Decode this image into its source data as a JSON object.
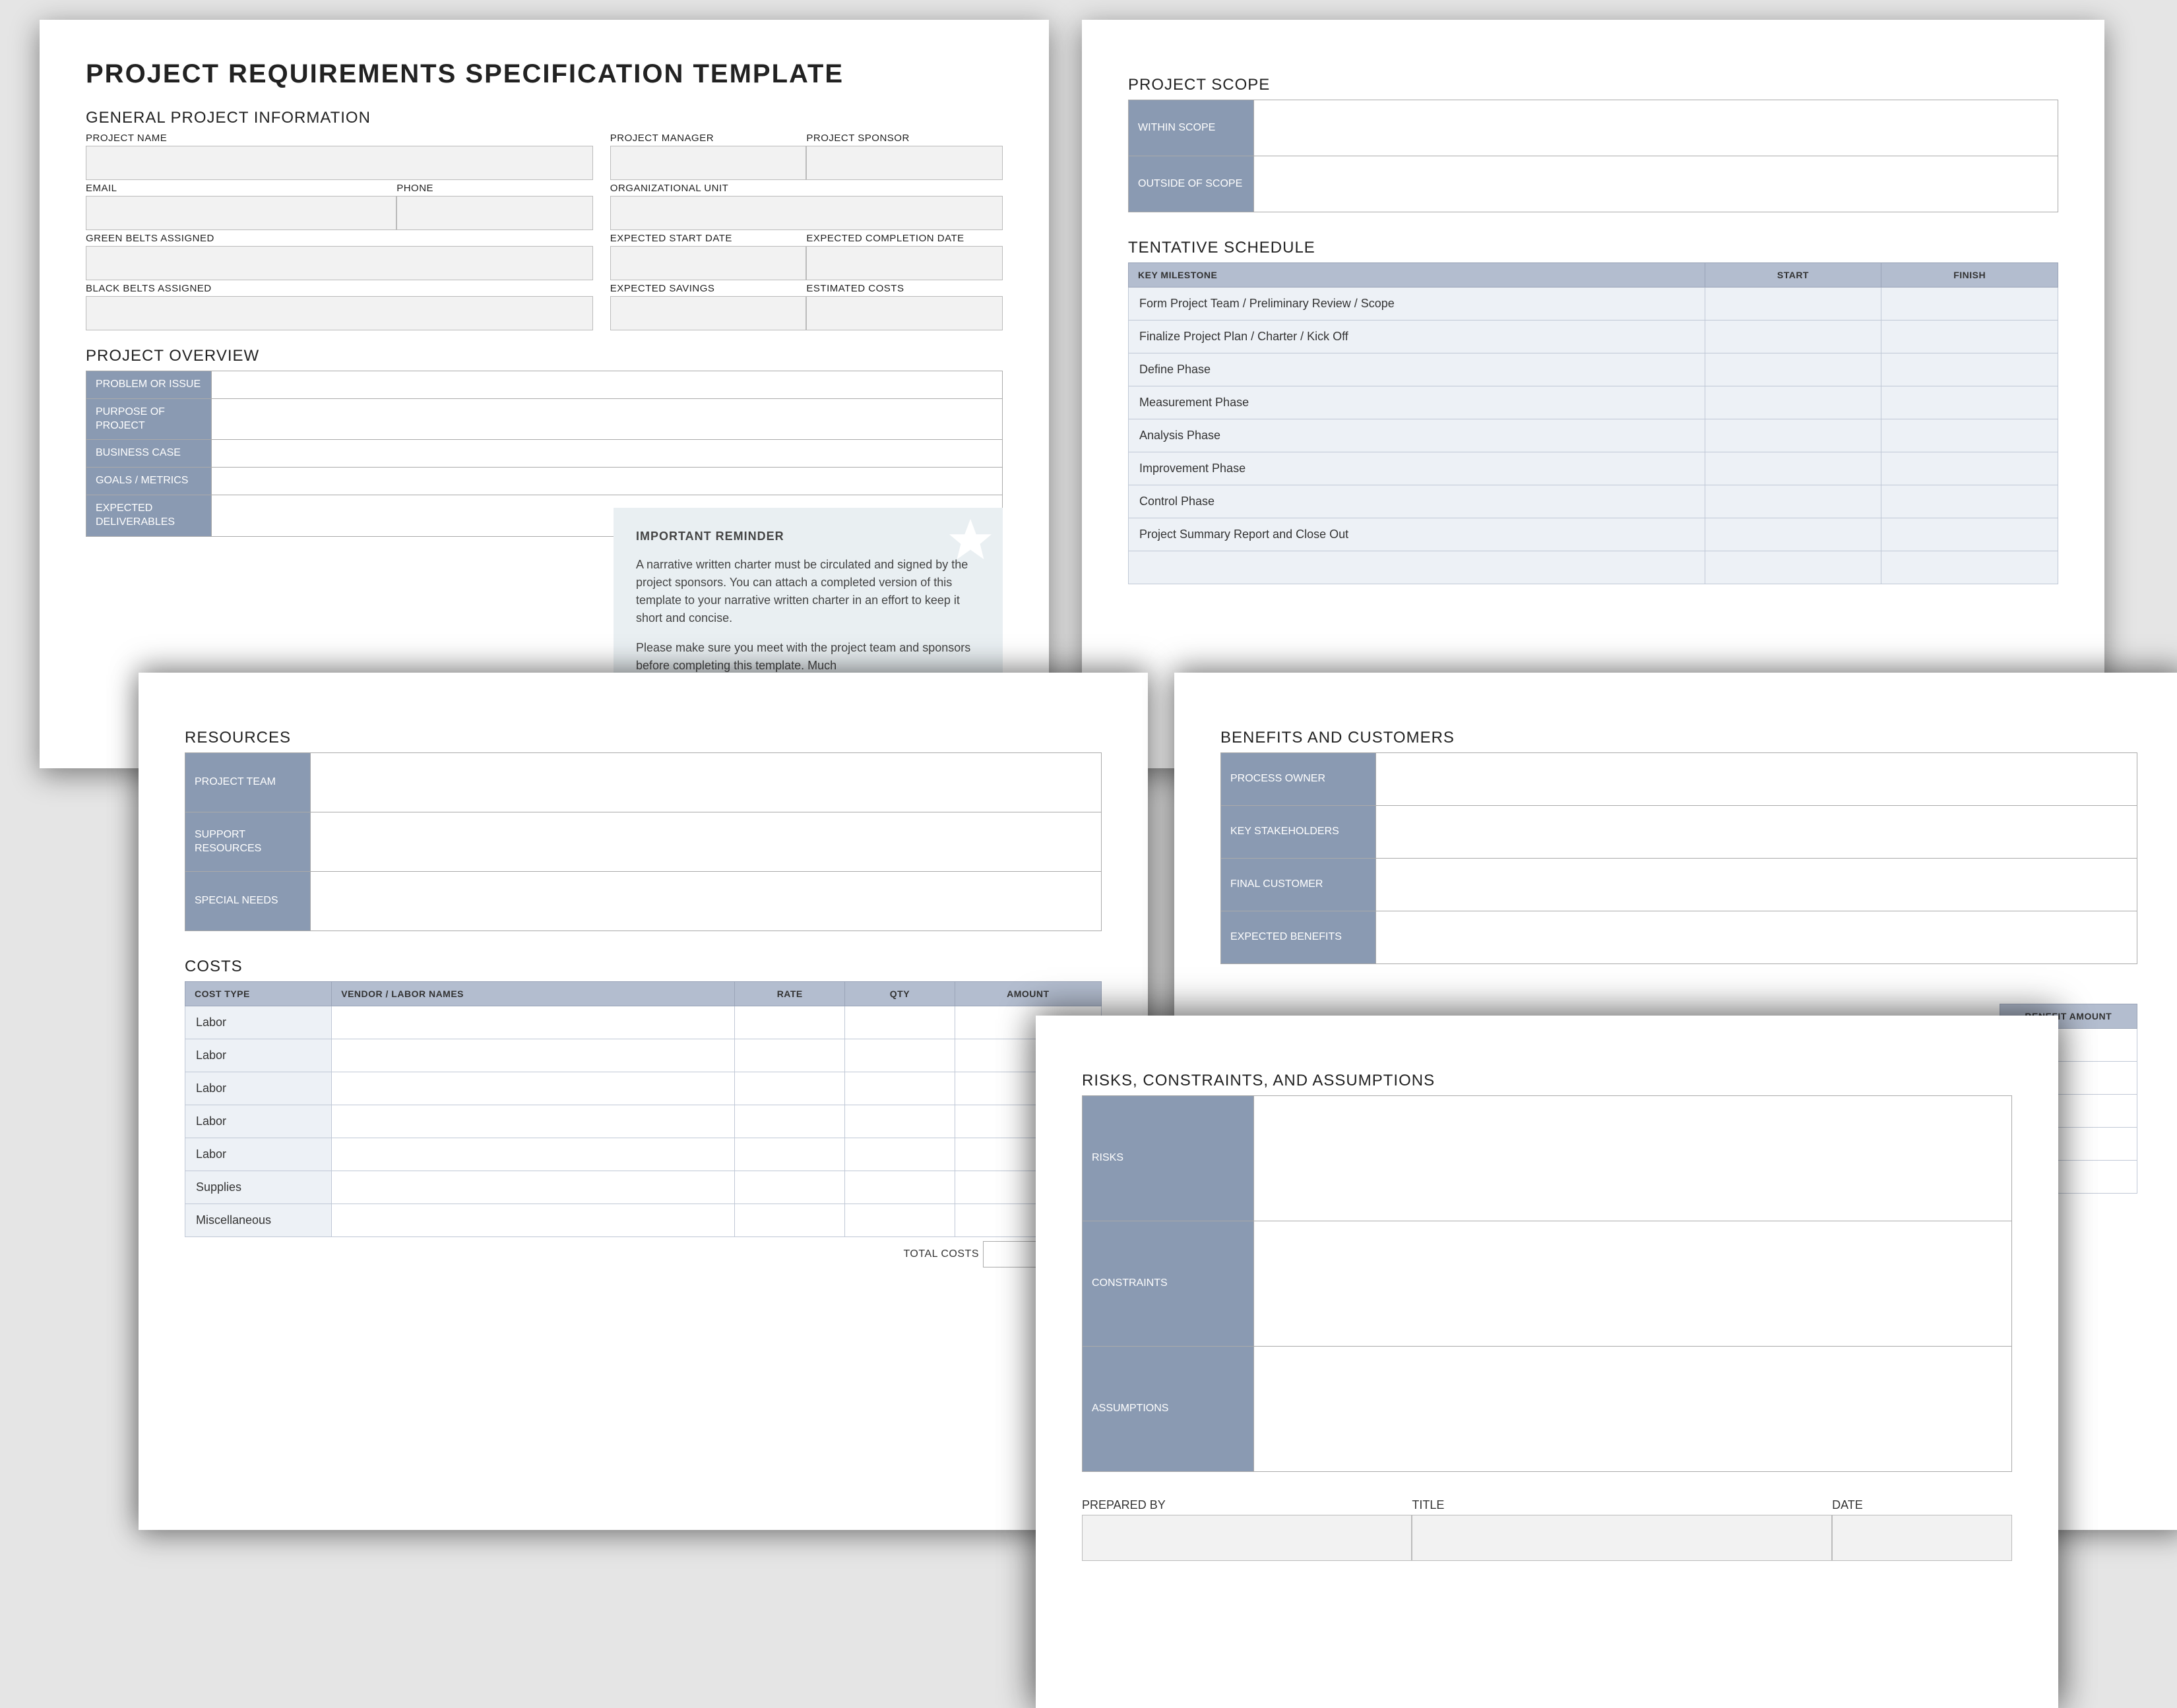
{
  "title": "PROJECT REQUIREMENTS SPECIFICATION TEMPLATE",
  "general": {
    "title": "GENERAL PROJECT INFORMATION",
    "project_name": "PROJECT NAME",
    "project_manager": "PROJECT MANAGER",
    "project_sponsor": "PROJECT SPONSOR",
    "email": "EMAIL",
    "phone": "PHONE",
    "org_unit": "ORGANIZATIONAL UNIT",
    "green_belts": "GREEN BELTS ASSIGNED",
    "expected_start": "EXPECTED START DATE",
    "expected_completion": "EXPECTED COMPLETION DATE",
    "black_belts": "BLACK BELTS ASSIGNED",
    "expected_savings": "EXPECTED SAVINGS",
    "estimated_costs": "ESTIMATED COSTS"
  },
  "overview": {
    "title": "PROJECT OVERVIEW",
    "rows": [
      "PROBLEM OR ISSUE",
      "PURPOSE OF PROJECT",
      "BUSINESS CASE",
      "GOALS / METRICS",
      "EXPECTED DELIVERABLES"
    ]
  },
  "reminder": {
    "heading": "IMPORTANT REMINDER",
    "p1": "A narrative written charter must be circulated and signed by the project sponsors. You can attach a completed version of this template to your narrative written charter in an effort to keep it short and concise.",
    "p2": "Please make sure you meet with the project team and sponsors before completing this template. Much"
  },
  "scope": {
    "title": "PROJECT SCOPE",
    "rows": [
      "WITHIN SCOPE",
      "OUTSIDE OF SCOPE"
    ]
  },
  "schedule": {
    "title": "TENTATIVE SCHEDULE",
    "headers": [
      "KEY MILESTONE",
      "START",
      "FINISH"
    ],
    "rows": [
      "Form Project Team / Preliminary Review / Scope",
      "Finalize Project Plan / Charter / Kick Off",
      "Define Phase",
      "Measurement Phase",
      "Analysis Phase",
      "Improvement Phase",
      "Control Phase",
      "Project Summary Report and Close Out"
    ]
  },
  "resources": {
    "title": "RESOURCES",
    "rows": [
      "PROJECT TEAM",
      "SUPPORT RESOURCES",
      "SPECIAL NEEDS"
    ]
  },
  "costs": {
    "title": "COSTS",
    "headers": [
      "COST TYPE",
      "VENDOR / LABOR NAMES",
      "RATE",
      "QTY",
      "AMOUNT"
    ],
    "rows": [
      "Labor",
      "Labor",
      "Labor",
      "Labor",
      "Labor",
      "Supplies",
      "Miscellaneous"
    ],
    "total": "TOTAL COSTS"
  },
  "benefits": {
    "title": "BENEFITS AND CUSTOMERS",
    "rows": [
      "PROCESS OWNER",
      "KEY STAKEHOLDERS",
      "FINAL CUSTOMER",
      "EXPECTED BENEFITS"
    ],
    "amount": "BENEFIT AMOUNT"
  },
  "risks": {
    "title": "RISKS, CONSTRAINTS, AND ASSUMPTIONS",
    "rows": [
      "RISKS",
      "CONSTRAINTS",
      "ASSUMPTIONS"
    ]
  },
  "sig": {
    "prepared": "PREPARED BY",
    "title": "TITLE",
    "date": "DATE"
  }
}
